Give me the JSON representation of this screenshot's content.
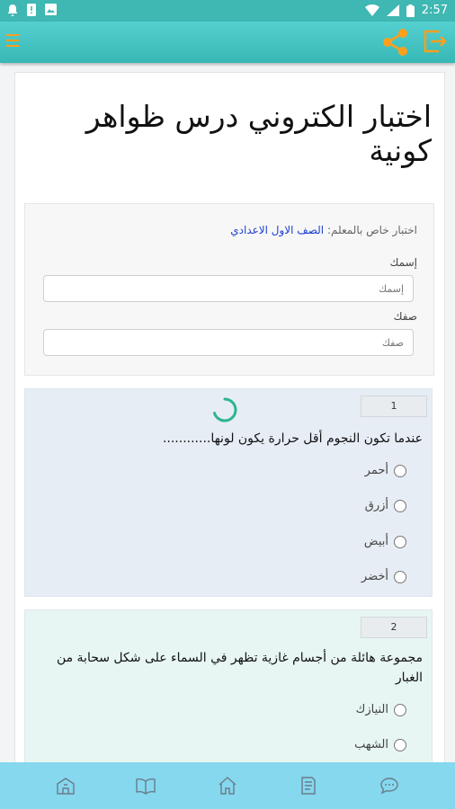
{
  "status": {
    "time": "2:57"
  },
  "page": {
    "title": "اختبار الكتروني درس ظواهر كونية"
  },
  "info": {
    "teacher_prefix": "اختبار خاص بالمعلم:",
    "class_name": "الصف الاول الاعدادي",
    "name_label": "إسمك",
    "name_placeholder": "إسمك",
    "class_label": "صفك",
    "class_placeholder": "صفك"
  },
  "questions": [
    {
      "number": "1",
      "text": "عندما تكون النجوم أقل حرارة يكون لونها............",
      "options": [
        "أحمر",
        "أزرق",
        "أبيض",
        "أخضر"
      ]
    },
    {
      "number": "2",
      "text": "مجموعة هائلة من أجسام غازية تظهر في السماء على شكل سحابة من الغبار",
      "options": [
        "النيازك",
        "الشهب"
      ]
    }
  ],
  "colors": {
    "accent": "#ff9f1c",
    "appbar": "#3fb7b2",
    "bottombar": "#85d8ee"
  }
}
